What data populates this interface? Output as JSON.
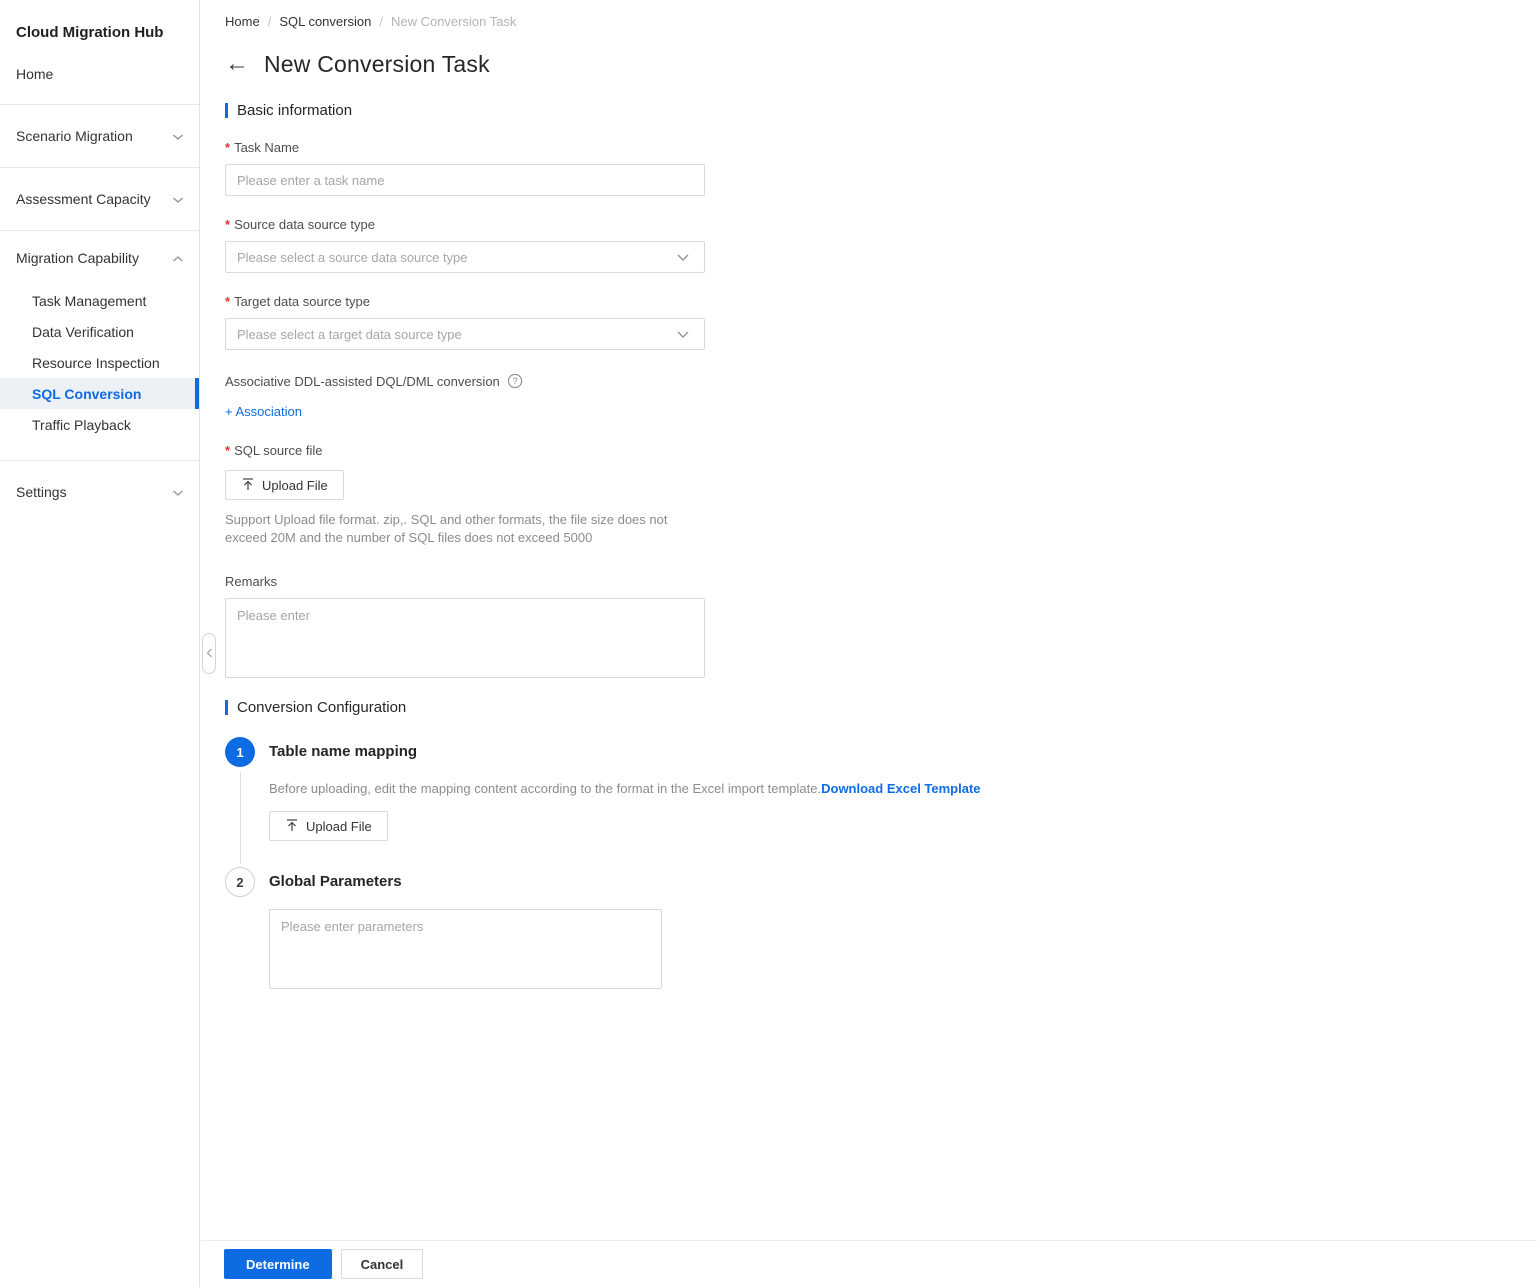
{
  "app": {
    "title": "Cloud Migration Hub"
  },
  "sidebar": {
    "home_label": "Home",
    "groups": {
      "scenario": {
        "label": "Scenario Migration"
      },
      "assessment": {
        "label": "Assessment Capacity"
      },
      "migration": {
        "label": "Migration Capability",
        "items": [
          "Task Management",
          "Data Verification",
          "Resource Inspection",
          "SQL Conversion",
          "Traffic Playback"
        ],
        "active_item": "SQL Conversion"
      },
      "settings": {
        "label": "Settings"
      }
    }
  },
  "breadcrumb": {
    "items": [
      "Home",
      "SQL conversion",
      "New Conversion Task"
    ],
    "separator": "/"
  },
  "page": {
    "title": "New Conversion Task",
    "back_icon": "←"
  },
  "marks": {
    "required": "*"
  },
  "basic": {
    "heading": "Basic information",
    "task_name": {
      "label": "Task Name",
      "placeholder": "Please enter a task name"
    },
    "source_type": {
      "label": "Source data source type",
      "placeholder": "Please select a source data source type"
    },
    "target_type": {
      "label": "Target data source type",
      "placeholder": "Please select a target data source type"
    },
    "association": {
      "label": "Associative DDL-assisted DQL/DML conversion",
      "add_link": "+ Association"
    },
    "sql_source": {
      "label": "SQL source file",
      "upload_label": "Upload File",
      "hint": "Support Upload file format. zip,. SQL and other formats, the file size does not exceed 20M and the number of SQL files does not exceed 5000"
    },
    "remarks": {
      "label": "Remarks",
      "placeholder": "Please enter"
    }
  },
  "conversion": {
    "heading": "Conversion Configuration",
    "steps": [
      {
        "num": "1",
        "title": "Table name mapping",
        "desc": "Before uploading, edit the mapping content according to the format in the Excel import template.",
        "link": "Download Excel Template",
        "upload_label": "Upload File"
      },
      {
        "num": "2",
        "title": "Global Parameters",
        "placeholder": "Please enter parameters"
      }
    ]
  },
  "footer": {
    "confirm_label": "Determine",
    "cancel_label": "Cancel"
  },
  "colors": {
    "accent": "#0d6ce2",
    "required_mark": "#df342c",
    "active_item_bg": "#edf0f5"
  }
}
